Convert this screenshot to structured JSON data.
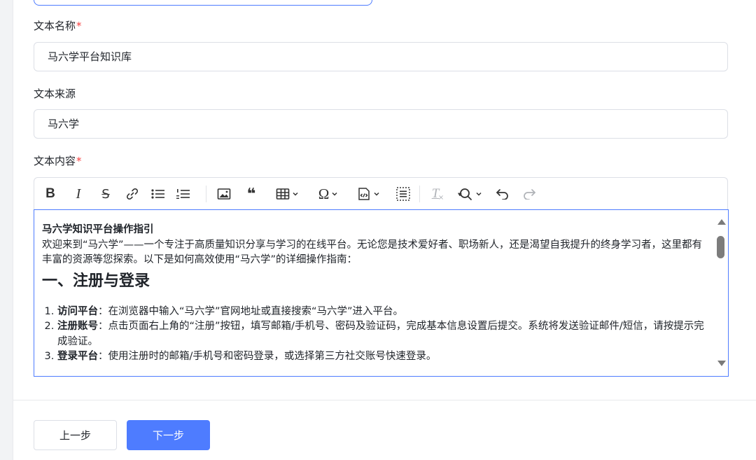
{
  "form": {
    "name_field": {
      "label": "文本名称",
      "required_mark": "*",
      "value": "马六学平台知识库"
    },
    "source_field": {
      "label": "文本来源",
      "value": "马六学"
    },
    "content_field": {
      "label": "文本内容",
      "required_mark": "*"
    }
  },
  "toolbar": {
    "items": [
      {
        "name": "bold",
        "glyph": "B"
      },
      {
        "name": "italic",
        "glyph": "I"
      },
      {
        "name": "strikethrough",
        "glyph": "S"
      },
      {
        "name": "link"
      },
      {
        "name": "bulleted-list"
      },
      {
        "name": "numbered-list"
      },
      {
        "name": "insert-image"
      },
      {
        "name": "blockquote",
        "glyph": "❝"
      },
      {
        "name": "insert-table"
      },
      {
        "name": "special-characters",
        "glyph": "Ω"
      },
      {
        "name": "source-code"
      },
      {
        "name": "select-all"
      },
      {
        "name": "remove-format",
        "glyph": "T"
      },
      {
        "name": "find-replace"
      },
      {
        "name": "undo"
      },
      {
        "name": "redo"
      }
    ]
  },
  "editor": {
    "title": "马六学知识平台操作指引",
    "intro": "欢迎来到“马六学”——一个专注于高质量知识分享与学习的在线平台。无论您是技术爱好者、职场新人，还是渴望自我提升的终身学习者，这里都有丰富的资源等您探索。以下是如何高效使用“马六学”的详细操作指南：",
    "heading": "一、注册与登录",
    "list": [
      {
        "term": "访问平台",
        "text": "：在浏览器中输入“马六学”官网地址或直接搜索“马六学”进入平台。"
      },
      {
        "term": "注册账号",
        "text": "：点击页面右上角的“注册”按钮，填写邮箱/手机号、密码及验证码，完成基本信息设置后提交。系统将发送验证邮件/短信，请按提示完成验证。"
      },
      {
        "term": "登录平台",
        "text": "：使用注册时的邮箱/手机号和密码登录，或选择第三方社交账号快速登录。"
      }
    ]
  },
  "buttons": {
    "prev": "上一步",
    "next": "下一步"
  },
  "colors": {
    "primary": "#4e7cff",
    "required": "#f53f3f",
    "border": "#dcdfe6"
  }
}
